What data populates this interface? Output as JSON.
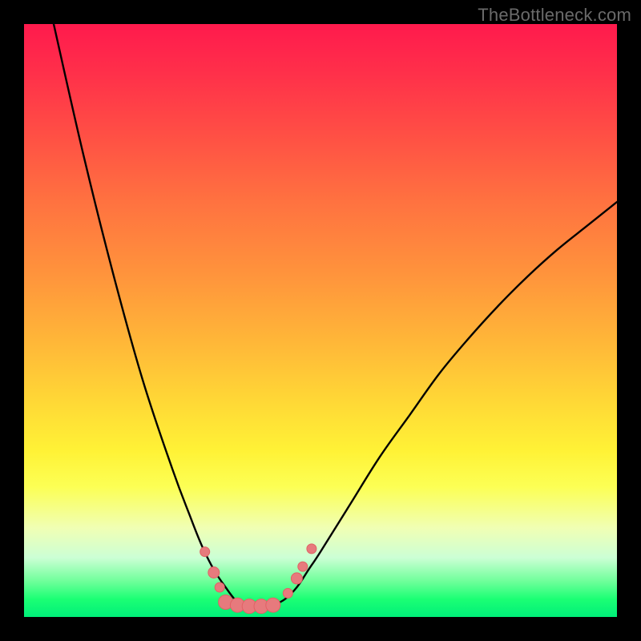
{
  "watermark": "TheBottleneck.com",
  "colors": {
    "frame_bg": "#000000",
    "curve_stroke": "#000000",
    "marker_fill": "#e77a7d",
    "marker_stroke": "#e06265",
    "gradient_top": "#ff1a4d",
    "gradient_mid": "#fff236",
    "gradient_bottom": "#00ef79"
  },
  "chart_data": {
    "type": "line",
    "title": "",
    "xlabel": "",
    "ylabel": "",
    "xlim": [
      0,
      100
    ],
    "ylim": [
      0,
      100
    ],
    "grid": false,
    "legend": false,
    "notes": "V-shaped bottleneck curve over a vertical rainbow gradient (red→yellow→green). Lower y = better (green zone). Curve minimum near x≈38. Salmon markers cluster around the trough. Right arm rises less steeply than left arm.",
    "series": [
      {
        "name": "bottleneck-curve",
        "x": [
          5,
          10,
          15,
          20,
          25,
          28,
          30,
          32,
          34,
          36,
          38,
          40,
          42,
          44,
          46,
          48,
          50,
          55,
          60,
          65,
          70,
          75,
          80,
          85,
          90,
          95,
          100
        ],
        "y": [
          100,
          78,
          58,
          40,
          25,
          17,
          12,
          8,
          5,
          2.5,
          1.5,
          1.5,
          2,
          3,
          5,
          8,
          11,
          19,
          27,
          34,
          41,
          47,
          52.5,
          57.5,
          62,
          66,
          70
        ]
      }
    ],
    "markers": [
      {
        "x": 30.5,
        "y": 11.0,
        "r": 6
      },
      {
        "x": 32.0,
        "y": 7.5,
        "r": 7
      },
      {
        "x": 33.0,
        "y": 5.0,
        "r": 6
      },
      {
        "x": 34.0,
        "y": 2.5,
        "r": 9
      },
      {
        "x": 36.0,
        "y": 2.0,
        "r": 9
      },
      {
        "x": 38.0,
        "y": 1.8,
        "r": 9
      },
      {
        "x": 40.0,
        "y": 1.8,
        "r": 9
      },
      {
        "x": 42.0,
        "y": 2.0,
        "r": 9
      },
      {
        "x": 44.5,
        "y": 4.0,
        "r": 6
      },
      {
        "x": 46.0,
        "y": 6.5,
        "r": 7
      },
      {
        "x": 47.0,
        "y": 8.5,
        "r": 6
      },
      {
        "x": 48.5,
        "y": 11.5,
        "r": 6
      }
    ]
  }
}
